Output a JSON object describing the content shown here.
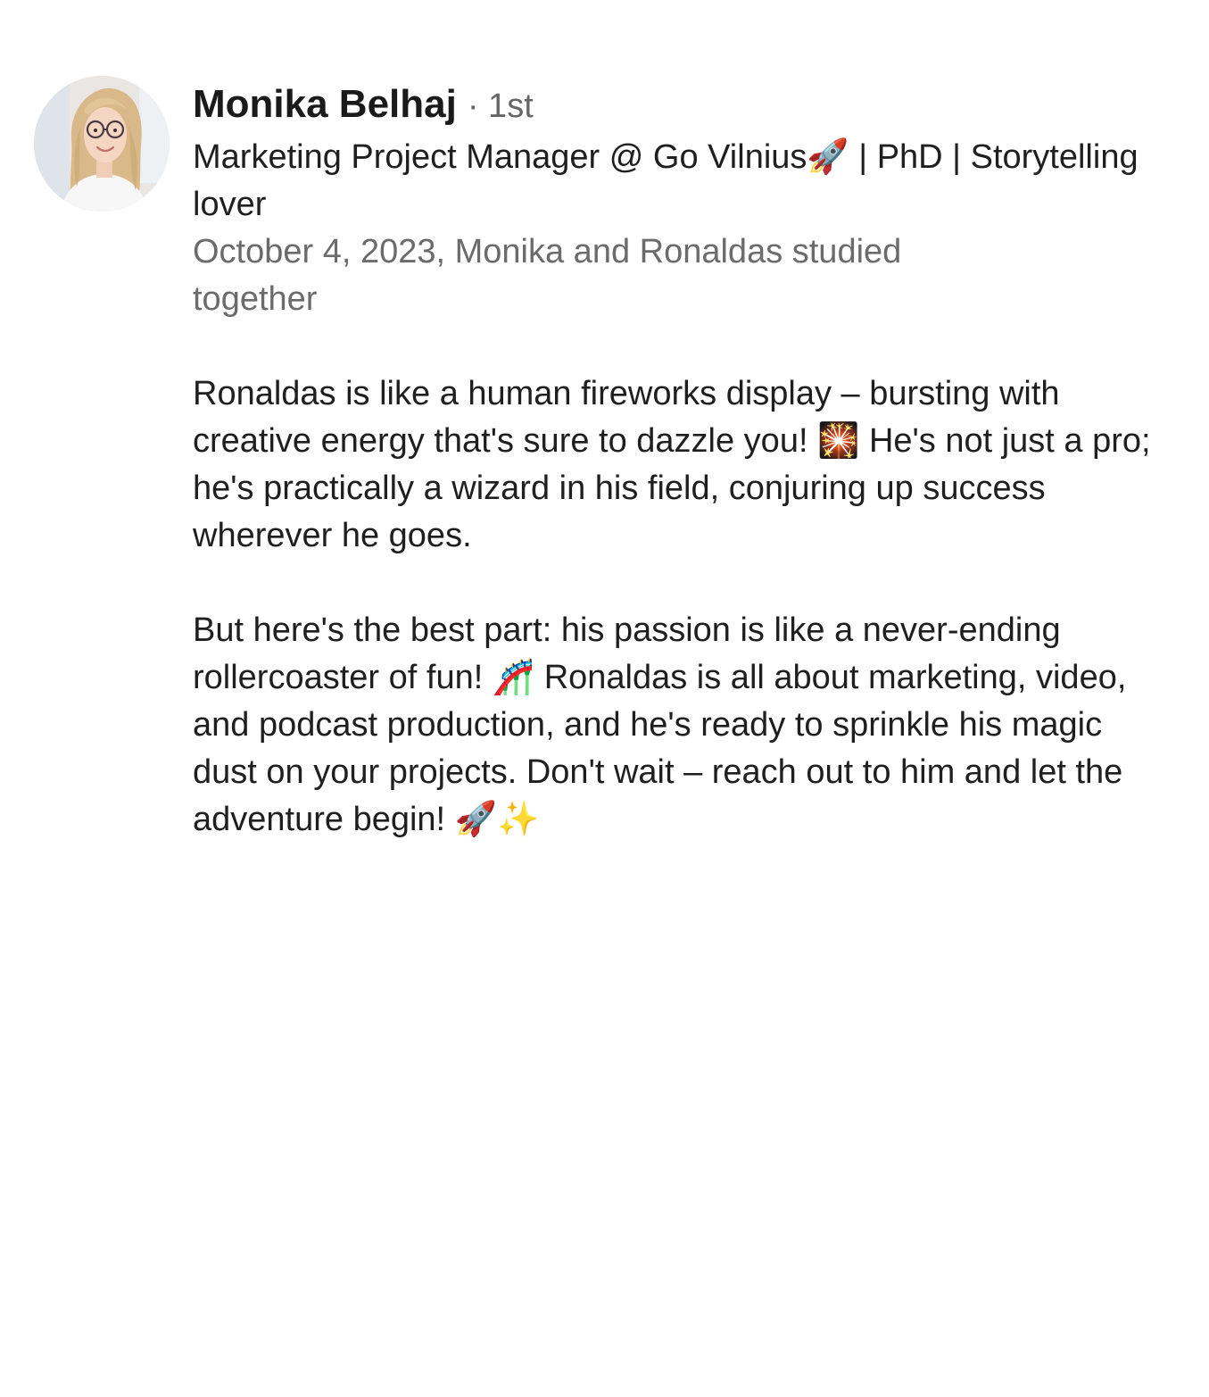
{
  "recommendation": {
    "author": {
      "name": "Monika Belhaj",
      "degree": "· 1st",
      "headline": "Marketing Project Manager @ Go Vilnius🚀 | PhD | Storytelling lover"
    },
    "meta": "October 4, 2023, Monika and Ronaldas studied together",
    "paragraphs": [
      "Ronaldas is like a human fireworks display – bursting with creative energy that's sure to dazzle you! 🎇 He's not just a pro; he's practically a wizard in his field, conjuring up success wherever he goes.",
      "But here's the best part: his passion is like a never-ending rollercoaster of fun! 🎢 Ronaldas is all about marketing, video, and podcast production, and he's ready to sprinkle his magic dust on your projects. Don't wait – reach out to him and let the adventure begin! 🚀✨"
    ]
  },
  "colors": {
    "primary_text": "#1f1f1f",
    "secondary_text": "#6b6b6b",
    "background": "#ffffff"
  }
}
